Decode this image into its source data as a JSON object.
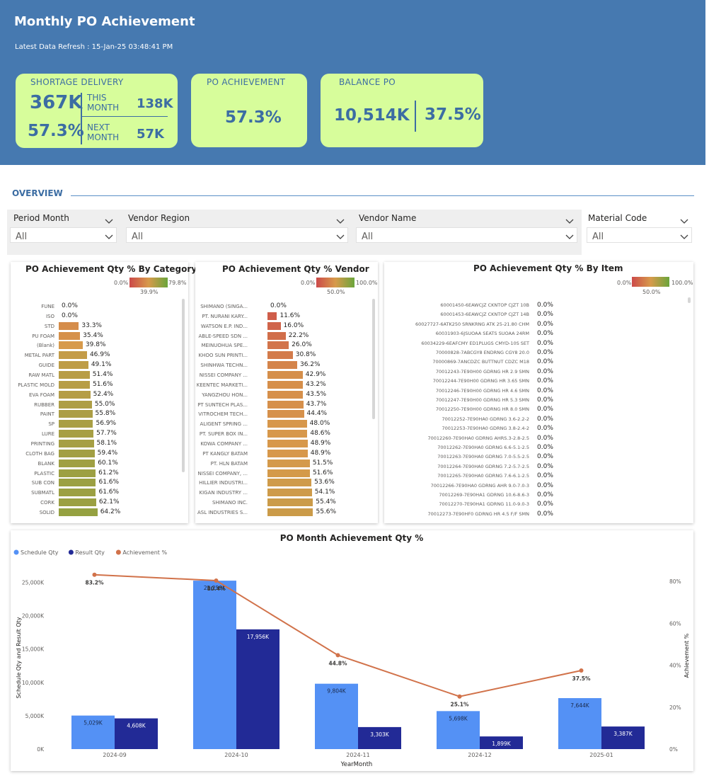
{
  "header": {
    "title": "Monthly PO Achievement",
    "refresh": "Latest Data Refresh : 15-Jan-25 03:48:41 PM"
  },
  "cards": {
    "shortage": {
      "title": "SHORTAGE DELIVERY",
      "total": "367K",
      "pct": "57.3%",
      "this_label": "THIS\nMONTH",
      "this_value": "138K",
      "next_label": "NEXT\nMONTH",
      "next_value": "57K"
    },
    "achievement": {
      "title": "PO ACHIEVEMENT",
      "value": "57.3%"
    },
    "balance": {
      "title": "BALANCE PO",
      "value": "10,514K",
      "pct": "37.5%"
    }
  },
  "overview": {
    "label": "OVERVIEW"
  },
  "slicers": [
    {
      "label": "Period Month",
      "value": "All"
    },
    {
      "label": "Vendor Region",
      "value": "All"
    },
    {
      "label": "Vendor Name",
      "value": "All"
    },
    {
      "label": "Material Code",
      "value": "All"
    }
  ],
  "category_panel": {
    "title": "PO Achievement Qty % By Category",
    "legend_min": "0.0%",
    "legend_mid": "39.9%",
    "legend_max": "79.8%",
    "rows": [
      {
        "label": "FUNE",
        "value": 0.0,
        "text": "0.0%"
      },
      {
        "label": "ISO",
        "value": 0.0,
        "text": "0.0%"
      },
      {
        "label": "STD",
        "value": 33.3,
        "text": "33.3%"
      },
      {
        "label": "PU FOAM",
        "value": 35.4,
        "text": "35.4%"
      },
      {
        "label": "(Blank)",
        "value": 39.8,
        "text": "39.8%"
      },
      {
        "label": "METAL PART",
        "value": 46.9,
        "text": "46.9%"
      },
      {
        "label": "GUIDE",
        "value": 49.1,
        "text": "49.1%"
      },
      {
        "label": "RAW MATL",
        "value": 51.4,
        "text": "51.4%"
      },
      {
        "label": "PLASTIC MOLD",
        "value": 51.6,
        "text": "51.6%"
      },
      {
        "label": "EVA FOAM",
        "value": 52.4,
        "text": "52.4%"
      },
      {
        "label": "RUBBER",
        "value": 55.0,
        "text": "55.0%"
      },
      {
        "label": "PAINT",
        "value": 55.8,
        "text": "55.8%"
      },
      {
        "label": "SP",
        "value": 56.9,
        "text": "56.9%"
      },
      {
        "label": "LURE",
        "value": 57.7,
        "text": "57.7%"
      },
      {
        "label": "PRINTING",
        "value": 58.1,
        "text": "58.1%"
      },
      {
        "label": "CLOTH BAG",
        "value": 59.4,
        "text": "59.4%"
      },
      {
        "label": "BLANK",
        "value": 60.1,
        "text": "60.1%"
      },
      {
        "label": "PLASTIC",
        "value": 61.2,
        "text": "61.2%"
      },
      {
        "label": "SUB CON",
        "value": 61.6,
        "text": "61.6%"
      },
      {
        "label": "SUBMATL",
        "value": 61.6,
        "text": "61.6%"
      },
      {
        "label": "CORK",
        "value": 62.1,
        "text": "62.1%"
      },
      {
        "label": "SOLID",
        "value": 64.2,
        "text": "64.2%"
      }
    ]
  },
  "vendor_panel": {
    "title": "PO Achievement Qty % Vendor",
    "legend_min": "0.0%",
    "legend_mid": "50.0%",
    "legend_max": "100.0%",
    "rows": [
      {
        "label": "SHIMANO (SINGA...",
        "value": 0.0,
        "text": "0.0%"
      },
      {
        "label": "PT. NURANI KARY...",
        "value": 11.6,
        "text": "11.6%"
      },
      {
        "label": "WATSON E.P. IND...",
        "value": 16.0,
        "text": "16.0%"
      },
      {
        "label": "ABLE-SPEED SDN ...",
        "value": 22.2,
        "text": "22.2%"
      },
      {
        "label": "MEINUOHUA SPE...",
        "value": 26.0,
        "text": "26.0%"
      },
      {
        "label": "KHOO SUN PRINTI...",
        "value": 30.8,
        "text": "30.8%"
      },
      {
        "label": "SHINHWA TECHN...",
        "value": 36.2,
        "text": "36.2%"
      },
      {
        "label": "NISSEI COMPANY ...",
        "value": 42.9,
        "text": "42.9%"
      },
      {
        "label": "KEENTEC MARKETI...",
        "value": 43.2,
        "text": "43.2%"
      },
      {
        "label": "YANGZHOU HON...",
        "value": 43.5,
        "text": "43.5%"
      },
      {
        "label": "PT SUNTECH PLAS...",
        "value": 43.7,
        "text": "43.7%"
      },
      {
        "label": "VITROCHEM TECH...",
        "value": 44.4,
        "text": "44.4%"
      },
      {
        "label": "ALIGENT SPRING ...",
        "value": 48.0,
        "text": "48.0%"
      },
      {
        "label": "PT. SUPER BOX IN...",
        "value": 48.6,
        "text": "48.6%"
      },
      {
        "label": "KOWA COMPANY ...",
        "value": 48.9,
        "text": "48.9%"
      },
      {
        "label": "PT KANGLY BATAM",
        "value": 48.9,
        "text": "48.9%"
      },
      {
        "label": "PT. HLN BATAM",
        "value": 51.5,
        "text": "51.5%"
      },
      {
        "label": "NISSEI COMPANY, ...",
        "value": 51.6,
        "text": "51.6%"
      },
      {
        "label": "HILLIER INDUSTRI...",
        "value": 53.6,
        "text": "53.6%"
      },
      {
        "label": "KIGAN INDUSTRY ...",
        "value": 54.1,
        "text": "54.1%"
      },
      {
        "label": "SHIMANO INC.",
        "value": 55.4,
        "text": "55.4%"
      },
      {
        "label": "ASL INDUSTRIES S...",
        "value": 55.6,
        "text": "55.6%"
      }
    ]
  },
  "item_panel": {
    "title": "PO Achievement Qty % By Item",
    "legend_min": "0.0%",
    "legend_mid": "50.0%",
    "legend_max": "100.0%",
    "rows": [
      {
        "label": "60001450-6EAWCJZ CKNTOP CJZT 10B",
        "text": "0.0%"
      },
      {
        "label": "60001453-6EAWCJZ CKNTOP CJZT 14B",
        "text": "0.0%"
      },
      {
        "label": "60027727-6ATK250 SRNKRNG ATK 25-21.80 CHM",
        "text": "0.0%"
      },
      {
        "label": "60031903-6JSUOAA SEATS SUOAA 24RM",
        "text": "0.0%"
      },
      {
        "label": "60034229-6EAFCMY ED1PLUGS CMYD-10S SET",
        "text": "0.0%"
      },
      {
        "label": "70000828-7ABCGY8 ENDRNG CGY8 20.0",
        "text": "0.0%"
      },
      {
        "label": "70000869-7ANCDZC BUTTNUT CDZC M18",
        "text": "0.0%"
      },
      {
        "label": "70012243-7E90H00 GDRNG HR 2.9 SMN",
        "text": "0.0%"
      },
      {
        "label": "70012244-7E90H00 GDRNG HR 3.65 SMN",
        "text": "0.0%"
      },
      {
        "label": "70012246-7E90H00 GDRNG HR 4.6 SMN",
        "text": "0.0%"
      },
      {
        "label": "70012247-7E90H00 GDRNG HR 5.3 SMN",
        "text": "0.0%"
      },
      {
        "label": "70012250-7E90H00 GDRNG HR 8.0 SMN",
        "text": "0.0%"
      },
      {
        "label": "70012252-7E90HA0 GDRNG 3.6-2.2-2",
        "text": "0.0%"
      },
      {
        "label": "70012253-7E90HA0 GDRNG 3.8-2.4-2",
        "text": "0.0%"
      },
      {
        "label": "70012260-7E90HA0 GDRNG AHRS.3-2.8-2.5",
        "text": "0.0%"
      },
      {
        "label": "70012262-7E90HA0 GDRNG 6.6-5.1-2.5",
        "text": "0.0%"
      },
      {
        "label": "70012263-7E90HA0 GDRNG 7.0-5.5-2.5",
        "text": "0.0%"
      },
      {
        "label": "70012264-7E90HA0 GDRNG 7.2-5.7-2.5",
        "text": "0.0%"
      },
      {
        "label": "70012265-7E90HA0 GDRNG 7.6-6.1-2.5",
        "text": "0.0%"
      },
      {
        "label": "70012266-7E90HA0 GDRNG AHR 9.0-7.0-3",
        "text": "0.0%"
      },
      {
        "label": "70012269-7E90HA1 GDRNG 10.6-8.6-3",
        "text": "0.0%"
      },
      {
        "label": "70012270-7E90HA1 GDRNG 11.0-9.0-3",
        "text": "0.0%"
      },
      {
        "label": "70012273-7E90HF0 GDRNG HR 4.5 F/F SMN",
        "text": "0.0%"
      }
    ]
  },
  "chart_data": {
    "type": "bar",
    "title": "PO Month Achievement Qty %",
    "xlabel": "YearMonth",
    "ylabel": "Schedule Qty and Result Qty",
    "y2label": "Achievement %",
    "categories": [
      "2024-09",
      "2024-10",
      "2024-11",
      "2024-12",
      "2025-01"
    ],
    "series": [
      {
        "name": "Schedule Qty",
        "type": "bar",
        "color": "#5491f5",
        "values": [
          5029,
          25259,
          9804,
          5698,
          7644
        ],
        "labels": [
          "5,029K",
          "25,259K",
          "9,804K",
          "5,698K",
          "7,644K"
        ]
      },
      {
        "name": "Result Qty",
        "type": "bar",
        "color": "#222a96",
        "values": [
          4608,
          17956,
          3303,
          1899,
          3387
        ],
        "labels": [
          "4,608K",
          "17,956K",
          "3,303K",
          "1,899K",
          "3,387K"
        ]
      },
      {
        "name": "Achievement %",
        "type": "line",
        "color": "#d1724a",
        "values": [
          83.2,
          80.4,
          44.8,
          25.1,
          37.5
        ],
        "labels": [
          "83.2%",
          "80.4%",
          "44.8%",
          "25.1%",
          "37.5%"
        ]
      }
    ],
    "ylim": [
      0,
      27500
    ],
    "yticks": [
      "0K",
      "5,000K",
      "10,000K",
      "15,000K",
      "20,000K",
      "25,000K"
    ],
    "y2lim": [
      0,
      87.5
    ],
    "y2ticks": [
      "0%",
      "20%",
      "40%",
      "60%",
      "80%"
    ],
    "legend_position": "top-left"
  },
  "colors": {
    "header": "#4679b0",
    "card": "#d7fd9b",
    "card_text": "#3c6da3"
  }
}
